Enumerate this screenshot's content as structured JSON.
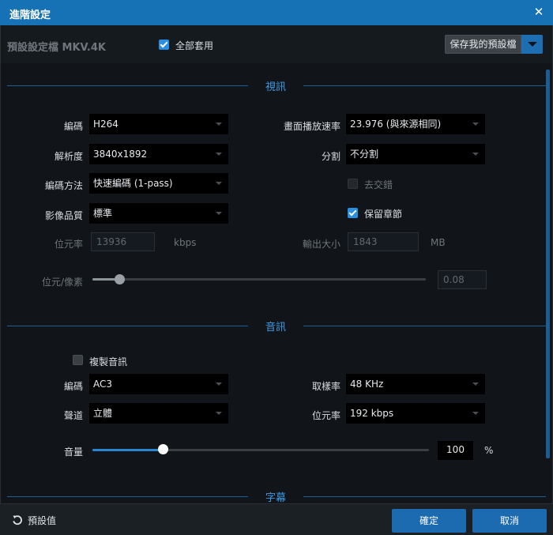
{
  "window": {
    "title": "進階設定",
    "close_glyph": "✕"
  },
  "topbar": {
    "preset_label": "預設設定檔  MKV.4K",
    "apply_all": {
      "label": "全部套用",
      "checked": true
    },
    "save_preset_label": "保存我的預設檔"
  },
  "sections": {
    "video": "視訊",
    "audio": "音訊",
    "subtitle": "字幕"
  },
  "video": {
    "codec": {
      "label": "編碼",
      "value": "H264"
    },
    "frame_rate": {
      "label": "畫面播放速率",
      "value": "23.976 (與來源相同)"
    },
    "resolution": {
      "label": "解析度",
      "value": "3840x1892"
    },
    "split": {
      "label": "分割",
      "value": "不分割"
    },
    "encode_method": {
      "label": "編碼方法",
      "value": "快速編碼 (1-pass)"
    },
    "deinterlace": {
      "label": "去交錯",
      "checked": false,
      "enabled": false
    },
    "quality": {
      "label": "影像品質",
      "value": "標準"
    },
    "keep_chapters": {
      "label": "保留章節",
      "checked": true
    },
    "bitrate": {
      "label": "位元率",
      "value": "13936",
      "unit": "kbps"
    },
    "output_size": {
      "label": "輸出大小",
      "value": "1843",
      "unit": "MB"
    },
    "bits_per_pixel": {
      "label": "位元/像素",
      "value": "0.08",
      "slider_fraction": 0.08
    }
  },
  "audio": {
    "copy_audio": {
      "label": "複製音訊",
      "checked": false
    },
    "codec": {
      "label": "編碼",
      "value": "AC3"
    },
    "sample_rate": {
      "label": "取樣率",
      "value": "48 KHz"
    },
    "channels": {
      "label": "聲道",
      "value": "立體"
    },
    "bitrate": {
      "label": "位元率",
      "value": "192 kbps"
    },
    "volume": {
      "label": "音量",
      "value": "100",
      "unit": "%",
      "slider_fraction": 0.21
    }
  },
  "footer": {
    "reset_label": "預設值",
    "ok_label": "確定",
    "cancel_label": "取消"
  },
  "colors": {
    "titlebar": "#1672b5",
    "accent": "#2a8fe0",
    "section_heading": "#3d9be6",
    "button": "#1c6ab0"
  }
}
